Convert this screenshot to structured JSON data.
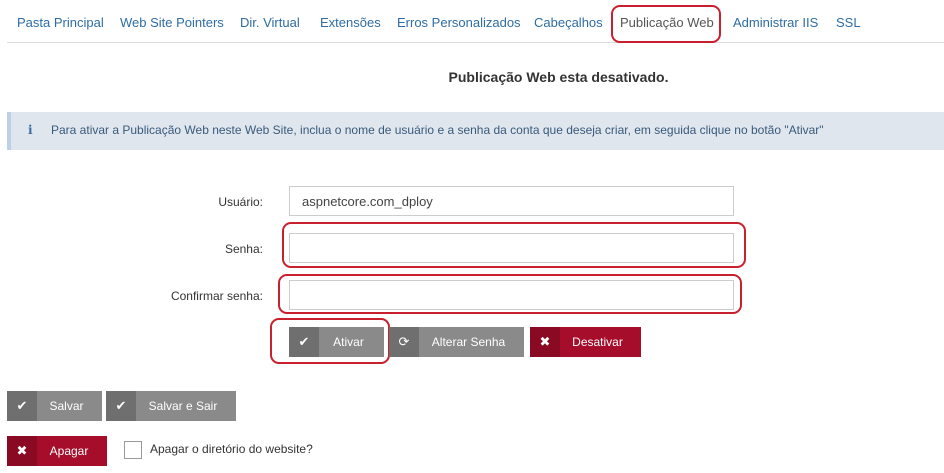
{
  "tabs": [
    {
      "label": "Pasta Principal"
    },
    {
      "label": "Web Site Pointers"
    },
    {
      "label": "Dir. Virtual"
    },
    {
      "label": "Extensões"
    },
    {
      "label": "Erros Personalizados"
    },
    {
      "label": "Cabeçalhos"
    },
    {
      "label": "Publicação Web"
    },
    {
      "label": "Administrar IIS"
    },
    {
      "label": "SSL"
    }
  ],
  "active_tab": "Publicação Web",
  "status_title": "Publicação Web esta desativado.",
  "info": {
    "icon": "info-icon",
    "text": "Para ativar a Publicação Web neste Web Site, inclua o nome de usuário e a senha da conta que deseja criar, em seguida clique no botão \"Ativar\""
  },
  "form": {
    "username_label": "Usuário:",
    "username_value": "aspnetcore.com_dploy",
    "password_label": "Senha:",
    "password_value": "",
    "confirm_label": "Confirmar senha:",
    "confirm_value": ""
  },
  "actions": {
    "ativar": "Ativar",
    "alterar_senha": "Alterar Senha",
    "desativar": "Desativar"
  },
  "footer": {
    "salvar": "Salvar",
    "salvar_sair": "Salvar e Sair",
    "apagar": "Apagar",
    "apagar_dir_label": "Apagar o diretório do website?",
    "apagar_dir_checked": false
  },
  "colors": {
    "link": "#2e6da4",
    "annotation": "#c8202e",
    "danger": "#a50d2b",
    "neutral": "#8a8a8a",
    "info_bg": "#dfe6ee"
  }
}
